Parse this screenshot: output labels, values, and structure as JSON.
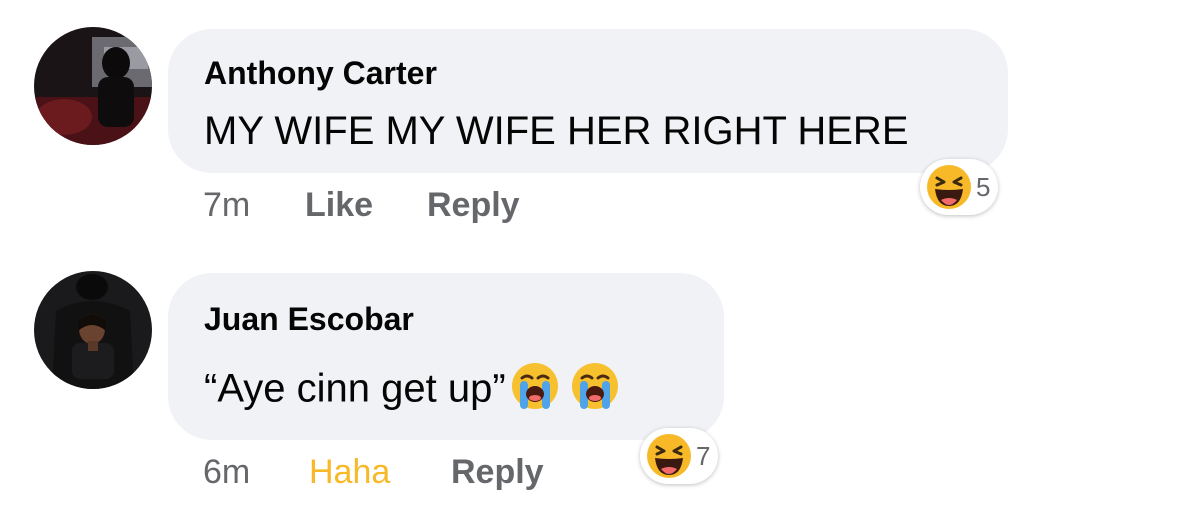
{
  "comments": [
    {
      "author": "Anthony Carter",
      "text": "MY WIFE MY WIFE HER RIGHT HERE",
      "time": "7m",
      "like_label": "Like",
      "reply_label": "Reply",
      "reaction_icon": "haha-icon",
      "reaction_count": "5"
    },
    {
      "author": "Juan Escobar",
      "text": "“Aye cinn get up”",
      "inline_emojis": [
        "loudly-crying-face-icon",
        "loudly-crying-face-icon"
      ],
      "time": "6m",
      "like_label": "Haha",
      "reply_label": "Reply",
      "reaction_icon": "haha-icon",
      "reaction_count": "7"
    }
  ],
  "colors": {
    "bubble": "#f0f2f5",
    "text": "#050505",
    "meta": "#65676b",
    "haha_active": "#f7b928"
  }
}
